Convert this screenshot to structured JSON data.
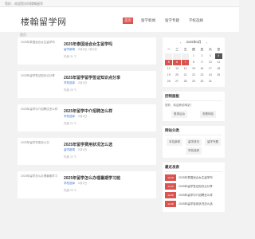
{
  "topbar": {
    "text": "您好，欢迎您访问楼翰留学"
  },
  "header": {
    "logo": "楼翰留学网"
  },
  "nav": [
    {
      "label": "首页",
      "active": true
    },
    {
      "label": "留学新闻",
      "active": false
    },
    {
      "label": "留学专题",
      "active": false
    },
    {
      "label": "学校选择",
      "active": false
    }
  ],
  "breadcrumb": "首页",
  "posts": [
    {
      "thumb_alt": "2025年泰国适合女生留学吗",
      "title": "2025年泰国适合女生留学吗",
      "category": "留学新闻",
      "date": "2月4日, 2月1日",
      "views": "热度 31 ℃"
    },
    {
      "thumb_alt": "2025年留学签证知识点分享",
      "title": "2025年留学留学签证知识点分享",
      "category": "学校选择",
      "date": "2月1日",
      "views": "热度 25 ℃"
    },
    {
      "thumb_alt": "2025年留学中介招聘应怎么样",
      "title": "2025年留学中介招聘怎么样",
      "category": "学校选择",
      "date": "2月1日",
      "views": "热度 24 ℃"
    },
    {
      "thumb_alt": "2025年留学学费怎么交",
      "title": "2025年留学费用状况怎么选",
      "category": "留学新闻",
      "date": "2月1日",
      "views": "热度 22 ℃"
    },
    {
      "thumb_alt": "2025年留学怎么办理暑期学习",
      "title": "2025年留学怎么办理暑期学习班",
      "category": "学校选择",
      "date": "2月1日",
      "views": "热度 20 ℃"
    }
  ],
  "calendar": {
    "title": "2025年5月",
    "weekdays": [
      "一",
      "二",
      "三",
      "四",
      "五",
      "六",
      "日"
    ],
    "days": [
      "",
      "",
      "",
      "1",
      "2",
      "3",
      "4",
      "5",
      "6",
      "7",
      "8",
      "9",
      "10",
      "11",
      "12",
      "13",
      "14",
      "15",
      "16",
      "17",
      "18",
      "19",
      "20",
      "21",
      "22",
      "23",
      "24",
      "25",
      "26",
      "27",
      "28",
      "29",
      "30",
      "31"
    ]
  },
  "login": {
    "title": "控制面板",
    "text": "您好，欢迎到访网站！",
    "buttons": [
      "登录后台",
      "查看网站"
    ]
  },
  "nav_box": {
    "title": "网站分类",
    "buttons": [
      "本站新闻",
      "留学资讯",
      "留学专题",
      "学校选择"
    ]
  },
  "news": {
    "title": "最近发表",
    "items": [
      {
        "date": "11-08",
        "text": "2025年泰国适合女生留学吗"
      },
      {
        "date": "11-08",
        "text": "2025年留学签证知识点分享"
      },
      {
        "date": "11-08",
        "text": "2025年留学中介招聘怎么样"
      },
      {
        "date": "11-08",
        "text": "2025年留学费用状况怎么选"
      }
    ]
  }
}
